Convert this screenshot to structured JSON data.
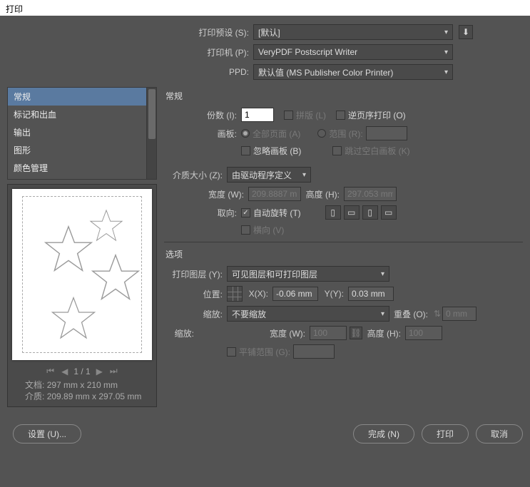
{
  "title": "打印",
  "top": {
    "preset_label": "打印预设 (S):",
    "preset_value": "[默认]",
    "printer_label": "打印机 (P):",
    "printer_value": "VeryPDF Postscript Writer",
    "ppd_label": "PPD:",
    "ppd_value": "默认值 (MS Publisher Color Printer)"
  },
  "side_items": [
    "常规",
    "标记和出血",
    "输出",
    "图形",
    "颜色管理"
  ],
  "preview": {
    "page": "1 / 1",
    "doc_label": "文档:",
    "doc_value": "297 mm x 210 mm",
    "media_label": "介质:",
    "media_value": "209.89 mm x 297.05 mm"
  },
  "general": {
    "heading": "常规",
    "copies_label": "份数 (I):",
    "copies_value": "1",
    "collate_label": "拼版 (L)",
    "reverse_label": "逆页序打印 (O)",
    "artboard_label": "画板:",
    "all_pages_label": "全部页面 (A)",
    "range_label": "范围 (R):",
    "ignore_artboards_label": "忽略画板 (B)",
    "skip_blank_label": "跳过空白画板 (K)",
    "media_size_label": "介质大小 (Z):",
    "media_size_value": "由驱动程序定义",
    "width_label": "宽度 (W):",
    "width_value": "209.8887 m",
    "height_label": "高度 (H):",
    "height_value": "297.053 mm",
    "orientation_label": "取向:",
    "auto_rotate_label": "自动旋转 (T)",
    "landscape_label": "横向 (V)"
  },
  "options": {
    "heading": "选项",
    "print_layers_label": "打印图层 (Y):",
    "print_layers_value": "可见图层和可打印图层",
    "position_label": "位置:",
    "x_label": "X(X):",
    "x_value": "-0.06 mm",
    "y_label": "Y(Y):",
    "y_value": "0.03 mm",
    "scaling_label": "缩放:",
    "scaling_value": "不要缩放",
    "overlap_label": "重叠 (O):",
    "overlap_value": "0 mm",
    "scale2_label": "缩放:",
    "w2_label": "宽度 (W):",
    "w2_value": "100",
    "h2_label": "高度 (H):",
    "h2_value": "100",
    "tile_label": "平铺范围 (G):"
  },
  "buttons": {
    "setup": "设置 (U)...",
    "done": "完成 (N)",
    "print": "打印",
    "cancel": "取消"
  }
}
